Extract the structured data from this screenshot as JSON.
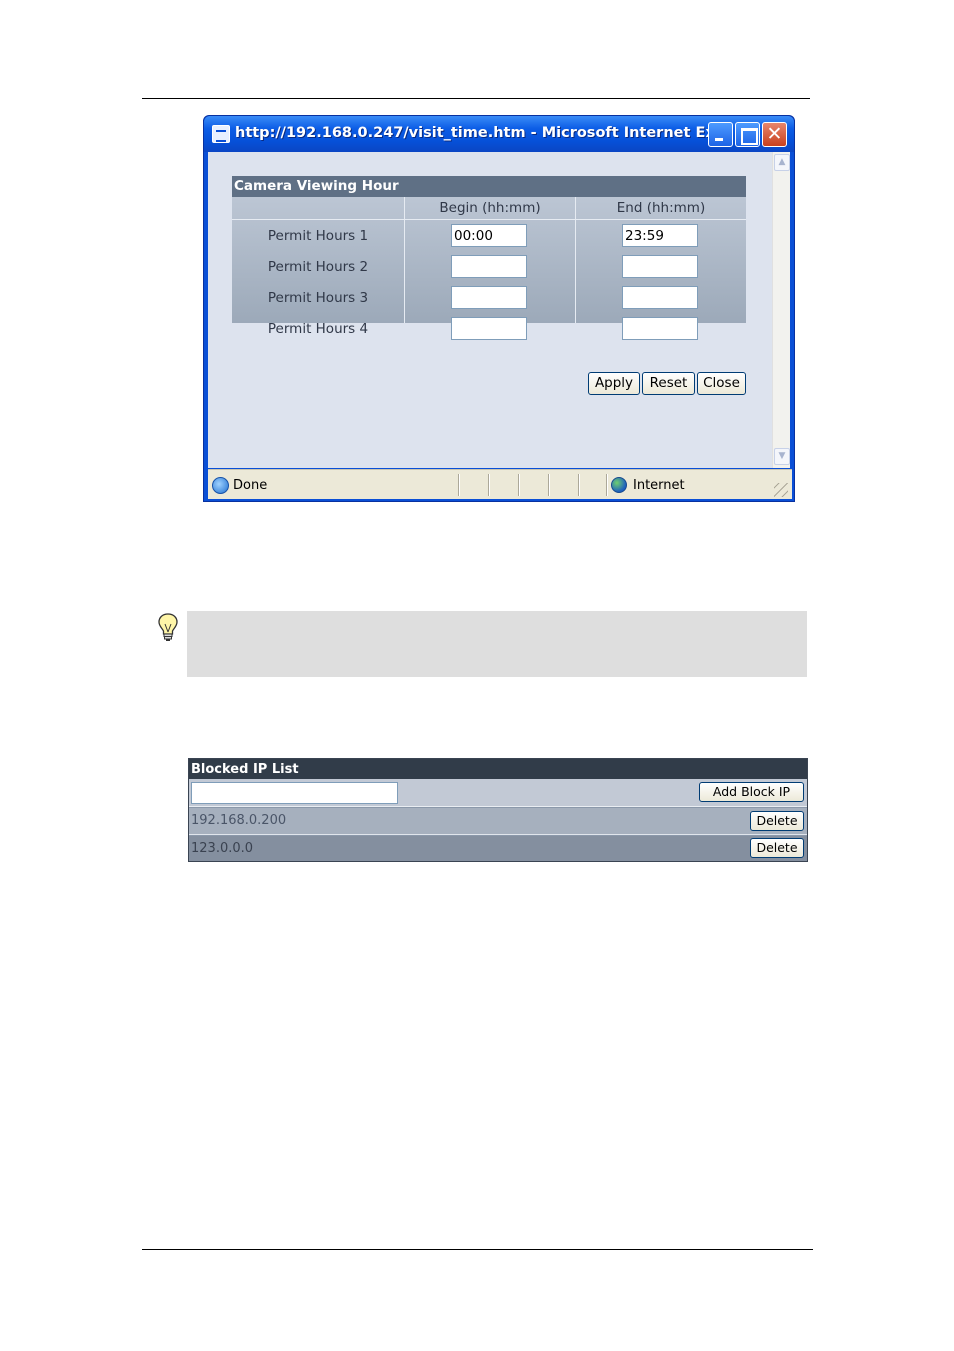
{
  "window": {
    "title": "http://192.168.0.247/visit_time.htm - Microsoft Internet Ex...",
    "close_glyph": "✕",
    "status_text": "Done",
    "zone_text": "Internet"
  },
  "camera_viewing": {
    "title": "Camera Viewing Hour",
    "col_begin": "Begin (hh:mm)",
    "col_end": "End (hh:mm)",
    "rows": [
      {
        "label": "Permit Hours 1",
        "begin": "00:00",
        "end": "23:59"
      },
      {
        "label": "Permit Hours 2",
        "begin": "",
        "end": ""
      },
      {
        "label": "Permit Hours 3",
        "begin": "",
        "end": ""
      },
      {
        "label": "Permit Hours 4",
        "begin": "",
        "end": ""
      }
    ],
    "apply_label": "Apply",
    "reset_label": "Reset",
    "close_label": "Close"
  },
  "blocked_ip": {
    "title": "Blocked IP List",
    "input_value": "",
    "add_label": "Add Block IP",
    "entries": [
      {
        "ip": "192.168.0.200",
        "delete_label": "Delete"
      },
      {
        "ip": "123.0.0.0",
        "delete_label": "Delete"
      }
    ]
  },
  "colors": {
    "title_bar": "#0a4fd6",
    "table_header": "#5f7085",
    "ip_header": "#313c49",
    "tip_background": "#dedede"
  }
}
